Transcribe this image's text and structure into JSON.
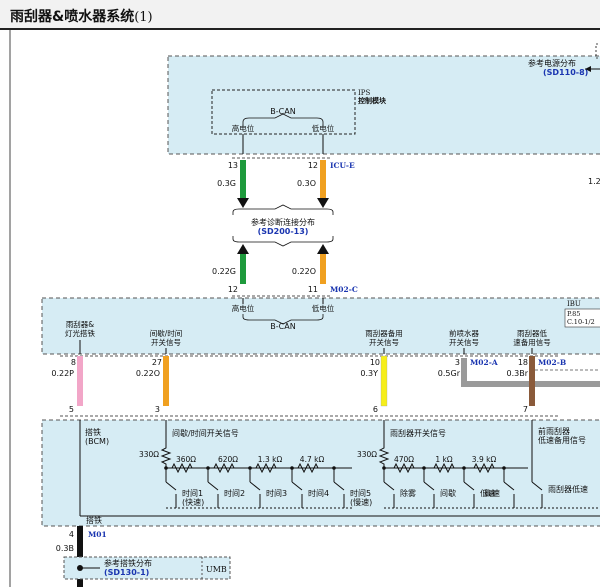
{
  "title": {
    "main": "雨刮器&喷水器系统",
    "sub": "(1)"
  },
  "colors": {
    "module_fill": "#d6ecf4",
    "wire_green": "#1e9a3c",
    "wire_orange": "#f0a020",
    "wire_pink": "#f2a6c8",
    "wire_yellow": "#f6ee1a",
    "wire_gray": "#9a9a9a",
    "wire_brown": "#8a5a3a",
    "wire_black": "#111111",
    "connector_blue": "#1a35b0"
  },
  "top": {
    "power_ref": "参考电源分布",
    "power_ref_code": "(SD110-8)",
    "ips": "IPS",
    "ips_name": "控制模块",
    "bcan": "B-CAN",
    "high": "高电位",
    "low": "低电位",
    "cutoff_label": "1.2"
  },
  "icu_wires": {
    "pin_left": "13",
    "pin_right": "12",
    "connector": "ICU-E",
    "wire_left": "0.3G",
    "wire_right": "0.3O"
  },
  "diag_ref": {
    "text": "参考诊断连接分布",
    "code": "(SD200-13)"
  },
  "ibu_wires": {
    "wire_left": "0.22G",
    "wire_right": "0.22O",
    "pin_left": "12",
    "pin_right": "11",
    "connector": "M02-C"
  },
  "ibu": {
    "name": "IBU",
    "page_ref1": "P.85",
    "page_ref2": "C.10-1/2",
    "high": "高电位",
    "low": "低电位",
    "bcan": "B-CAN",
    "sig1": [
      "雨刮器&",
      "灯光搭铁"
    ],
    "sig2": [
      "间歇/时间",
      "开关信号"
    ],
    "sig3": [
      "雨刮器备用",
      "开关信号"
    ],
    "sig4": [
      "前喷水器",
      "开关信号"
    ],
    "sig5": [
      "雨刮器低",
      "速备用信号"
    ]
  },
  "mid_wires": {
    "p1": "8",
    "w1": "0.22P",
    "p2": "27",
    "w2": "0.22O",
    "p3": "10",
    "w3": "0.3Y",
    "p4": "3",
    "c4": "M02-A",
    "w4": "0.5Gr",
    "p5": "18",
    "c5": "M02-B",
    "w5": "0.3Br"
  },
  "switch": {
    "pins": [
      "5",
      "3",
      "6",
      "7"
    ],
    "ground": [
      "搭铁",
      "(BCM)"
    ],
    "intermittent": "间歇/时间开关信号",
    "wiper_sw": "雨刮器开关信号",
    "front": [
      "前雨刮器",
      "低速备用信号"
    ],
    "r330a": "330Ω",
    "r330b": "330Ω",
    "r1": "360Ω",
    "r2": "620Ω",
    "r3": "1.3 kΩ",
    "r4": "4.7 kΩ",
    "r5": "470Ω",
    "r6": "1 kΩ",
    "r7": "3.9 kΩ",
    "t1a": "时间1",
    "t1b": "(快速)",
    "t2": "时间2",
    "t3": "时间3",
    "t4": "时间4",
    "t5a": "时间5",
    "t5b": "(慢速)",
    "mist": "除雾",
    "int": "间歇",
    "low": "低速",
    "high": "高速",
    "wlow": "雨刮器低速",
    "ground_bottom": "搭铁"
  },
  "bottom": {
    "pin": "4",
    "connector": "M01",
    "wire": "0.3B",
    "ground_ref": "参考搭铁分布",
    "ground_code": "(SD130-1)",
    "umb": "UMB"
  }
}
